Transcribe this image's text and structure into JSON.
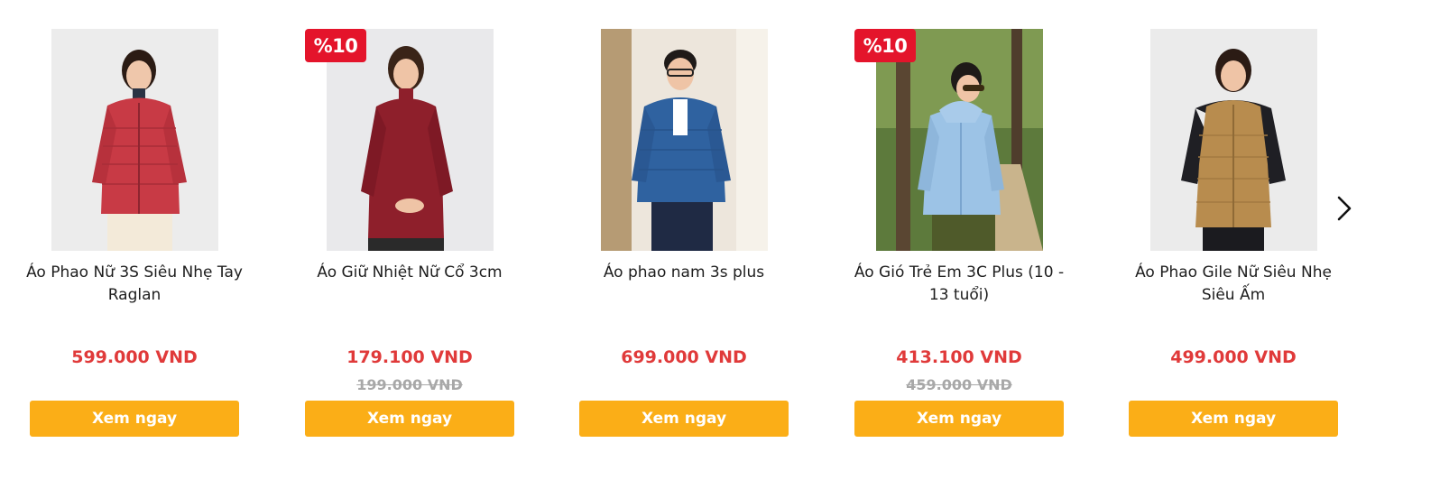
{
  "carousel": {
    "next_icon": "chevron-right-icon",
    "products": [
      {
        "title": "Áo Phao Nữ 3S Siêu Nhẹ Tay Raglan",
        "price": "599.000 VND",
        "old_price": "",
        "badge": "",
        "cta": "Xem ngay",
        "image_bg": "#ececec",
        "garment_color": "#c83a45"
      },
      {
        "title": "Áo Giữ Nhiệt Nữ Cổ 3cm",
        "price": "179.100 VND",
        "old_price": "199.000 VND",
        "badge": "%10",
        "cta": "Xem ngay",
        "image_bg": "#e9e9eb",
        "garment_color": "#8e1f2b"
      },
      {
        "title": "Áo phao nam 3s plus",
        "price": "699.000 VND",
        "old_price": "",
        "badge": "",
        "cta": "Xem ngay",
        "image_bg": "#ede6dc",
        "garment_color": "#2f62a0"
      },
      {
        "title": "Áo Gió Trẻ Em 3C Plus (10 - 13 tuổi)",
        "price": "413.100 VND",
        "old_price": "459.000 VND",
        "badge": "%10",
        "cta": "Xem ngay",
        "image_bg": "#5d7a3c",
        "garment_color": "#9cc3e6"
      },
      {
        "title": "Áo Phao Gile Nữ Siêu Nhẹ Siêu Ấm",
        "price": "499.000 VND",
        "old_price": "",
        "badge": "",
        "cta": "Xem ngay",
        "image_bg": "#ebebeb",
        "garment_color": "#b88c4e"
      }
    ]
  }
}
